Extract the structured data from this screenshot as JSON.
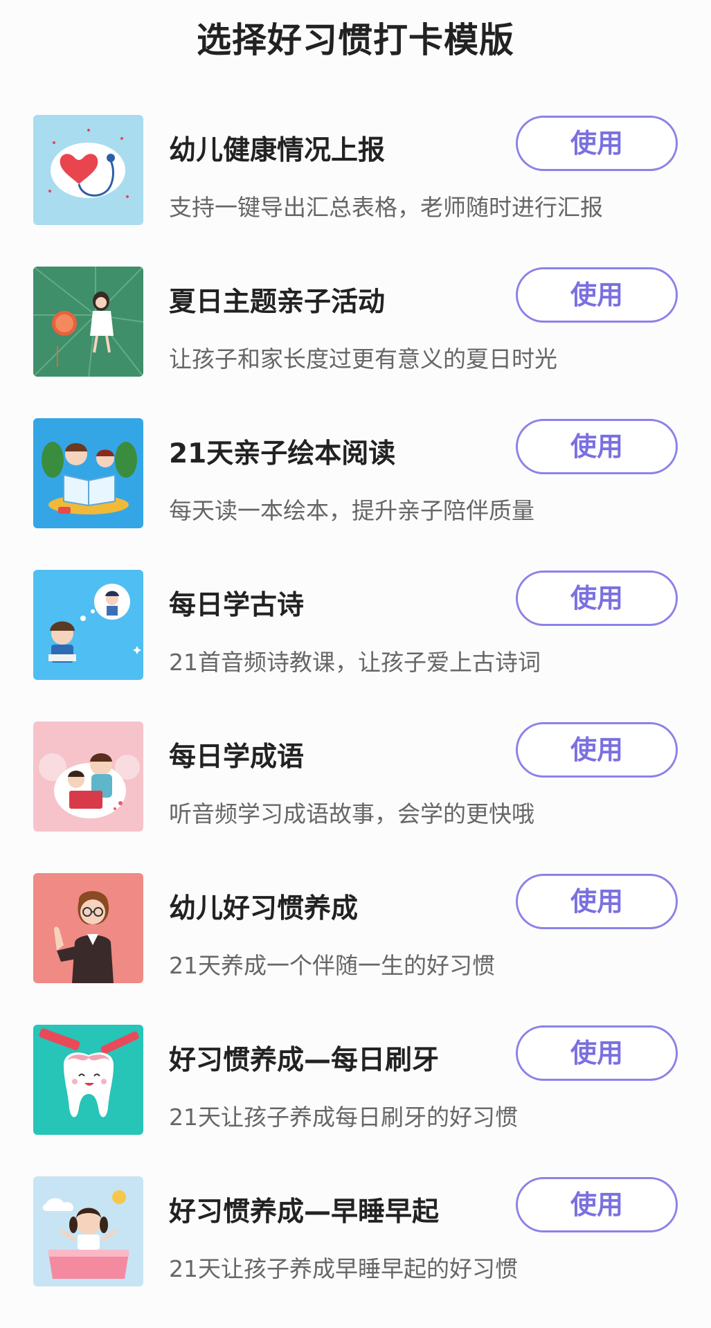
{
  "page": {
    "title": "选择好习惯打卡模版"
  },
  "colors": {
    "accent": "#7a70e0",
    "button_border": "#8b82e8",
    "title_text": "#222222",
    "desc_text": "#666666",
    "background": "#fcfcfd"
  },
  "templates": [
    {
      "title": "幼儿健康情况上报",
      "desc": "支持一键导出汇总表格，老师随时进行汇报",
      "button": "使用",
      "thumb_icon": "heart-stethoscope-icon",
      "thumb_bg": "#a9dcef"
    },
    {
      "title": "夏日主题亲子活动",
      "desc": "让孩子和家长度过更有意义的夏日时光",
      "button": "使用",
      "thumb_icon": "summer-girl-icon",
      "thumb_bg": "#3f8f6a"
    },
    {
      "title": "21天亲子绘本阅读",
      "desc": "每天读一本绘本，提升亲子陪伴质量",
      "button": "使用",
      "thumb_icon": "kids-reading-icon",
      "thumb_bg": "#34a6e6"
    },
    {
      "title": "每日学古诗",
      "desc": "21首音频诗教课，让孩子爱上古诗词",
      "button": "使用",
      "thumb_icon": "boy-poetry-icon",
      "thumb_bg": "#4fbef2"
    },
    {
      "title": "每日学成语",
      "desc": "听音频学习成语故事，会学的更快哦",
      "button": "使用",
      "thumb_icon": "parent-child-idiom-icon",
      "thumb_bg": "#f6c3ca"
    },
    {
      "title": "幼儿好习惯养成",
      "desc": "21天养成一个伴随一生的好习惯",
      "button": "使用",
      "thumb_icon": "teacher-icon",
      "thumb_bg": "#f08a84"
    },
    {
      "title": "好习惯养成—每日刷牙",
      "desc": "21天让孩子养成每日刷牙的好习惯",
      "button": "使用",
      "thumb_icon": "tooth-icon",
      "thumb_bg": "#27c4b8"
    },
    {
      "title": "好习惯养成—早睡早起",
      "desc": "21天让孩子养成早睡早起的好习惯",
      "button": "使用",
      "thumb_icon": "girl-wakeup-icon",
      "thumb_bg": "#c6e4f4"
    }
  ]
}
